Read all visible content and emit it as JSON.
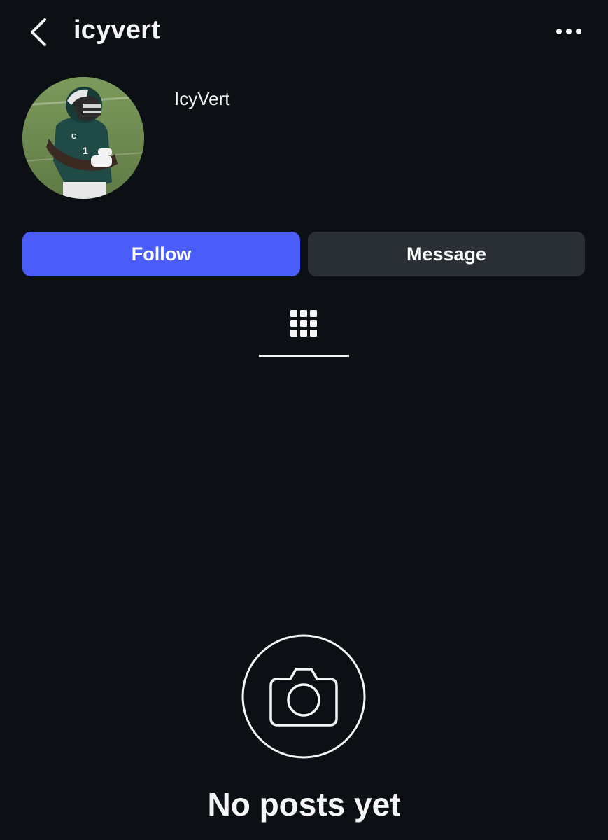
{
  "header": {
    "back_icon": "chevron-left-icon",
    "username": "icyvert",
    "more_icon": "more-horizontal-icon"
  },
  "profile": {
    "display_name": "IcyVert",
    "avatar_alt": "profile photo"
  },
  "actions": {
    "follow_label": "Follow",
    "message_label": "Message"
  },
  "tabs": {
    "active": "grid-icon"
  },
  "empty_state": {
    "icon": "camera-icon",
    "title": "No posts yet"
  },
  "colors": {
    "background": "#0c1014",
    "follow_button": "#4a5df9",
    "message_button": "#2a2f36",
    "text": "#f5f5f5"
  }
}
